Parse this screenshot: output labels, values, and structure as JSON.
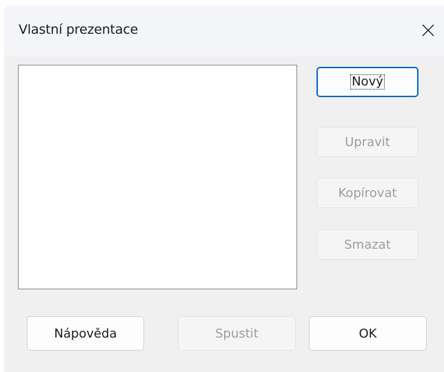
{
  "window": {
    "title": "Vlastní prezentace",
    "close_icon": "close-icon"
  },
  "shows_list": {
    "items": []
  },
  "buttons": {
    "new": "Nový",
    "edit": "Upravit",
    "copy": "Kopírovat",
    "delete": "Smazat",
    "help": "Nápověda",
    "start": "Spustit",
    "ok": "OK"
  },
  "colors": {
    "accent": "#0067c0",
    "disabled_text": "#9d9d9d",
    "dialog_background": "#f0f0f0"
  }
}
